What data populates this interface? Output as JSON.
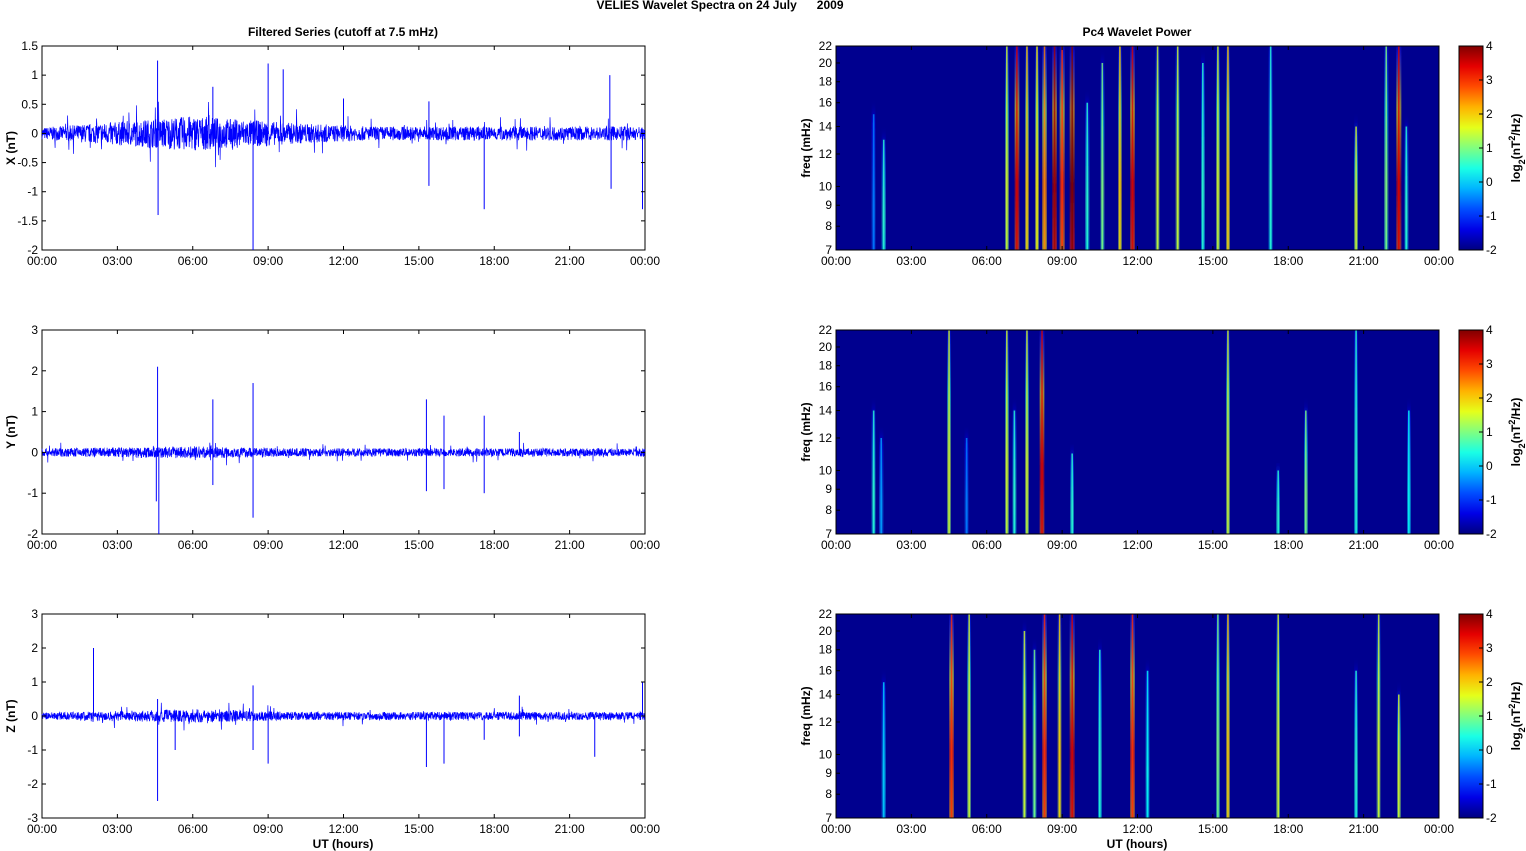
{
  "figure": {
    "title": "VELIES Wavelet Spectra on 24 July      2009",
    "left_title": "Filtered Series (cutoff at 7.5 mHz)",
    "right_title": "Pc4 Wavelet Power",
    "xlabel": "UT (hours)"
  },
  "colors": {
    "line": "#0000ff",
    "axis": "#000000",
    "background": "#00008f"
  },
  "chart_data": [
    {
      "type": "line",
      "name": "X",
      "ylabel": "X (nT)",
      "xlim": [
        0,
        24
      ],
      "ylim": [
        -2,
        1.5
      ],
      "yticks": [
        "-2",
        "-1.5",
        "-1",
        "-0.5",
        "0",
        "0.5",
        "1",
        "1.5"
      ],
      "xticks": [
        "00:00",
        "03:00",
        "06:00",
        "09:00",
        "12:00",
        "15:00",
        "18:00",
        "21:00",
        "00:00"
      ],
      "noise_amplitude": [
        [
          0,
          0.1
        ],
        [
          6,
          0.3
        ],
        [
          10,
          0.18
        ],
        [
          13,
          0.12
        ],
        [
          24,
          0.12
        ]
      ],
      "spikes": [
        [
          4.6,
          1.25
        ],
        [
          4.62,
          -1.4
        ],
        [
          6.8,
          0.8
        ],
        [
          8.4,
          -2.0
        ],
        [
          9.0,
          1.2
        ],
        [
          9.6,
          1.1
        ],
        [
          12.0,
          0.6
        ],
        [
          15.4,
          0.55
        ],
        [
          15.4,
          -0.9
        ],
        [
          17.6,
          -1.3
        ],
        [
          22.6,
          1.0
        ],
        [
          22.65,
          -0.95
        ],
        [
          23.9,
          -1.3
        ]
      ]
    },
    {
      "type": "line",
      "name": "Y",
      "ylabel": "Y (nT)",
      "xlim": [
        0,
        24
      ],
      "ylim": [
        -2,
        3
      ],
      "yticks": [
        "-2",
        "-1",
        "0",
        "1",
        "2",
        "3"
      ],
      "xticks": [
        "00:00",
        "03:00",
        "06:00",
        "09:00",
        "12:00",
        "15:00",
        "18:00",
        "21:00",
        "00:00"
      ],
      "noise_amplitude": [
        [
          0,
          0.1
        ],
        [
          6,
          0.15
        ],
        [
          10,
          0.1
        ],
        [
          24,
          0.1
        ]
      ],
      "spikes": [
        [
          4.6,
          2.1
        ],
        [
          4.65,
          -2.0
        ],
        [
          4.55,
          -1.2
        ],
        [
          6.8,
          1.3
        ],
        [
          6.8,
          -0.8
        ],
        [
          8.4,
          1.7
        ],
        [
          8.4,
          -1.6
        ],
        [
          15.3,
          1.3
        ],
        [
          15.3,
          -0.95
        ],
        [
          16.0,
          0.9
        ],
        [
          16.0,
          -0.9
        ],
        [
          17.6,
          0.9
        ],
        [
          17.6,
          -1.0
        ],
        [
          19.0,
          0.5
        ]
      ]
    },
    {
      "type": "line",
      "name": "Z",
      "ylabel": "Z (nT)",
      "xlim": [
        0,
        24
      ],
      "ylim": [
        -3,
        3
      ],
      "yticks": [
        "-3",
        "-2",
        "-1",
        "0",
        "1",
        "2",
        "3"
      ],
      "xticks": [
        "00:00",
        "03:00",
        "06:00",
        "09:00",
        "12:00",
        "15:00",
        "18:00",
        "21:00",
        "00:00"
      ],
      "noise_amplitude": [
        [
          0,
          0.1
        ],
        [
          6,
          0.2
        ],
        [
          10,
          0.12
        ],
        [
          24,
          0.12
        ]
      ],
      "spikes": [
        [
          2.05,
          2.0
        ],
        [
          4.6,
          -2.5
        ],
        [
          4.6,
          0.5
        ],
        [
          5.3,
          -1.0
        ],
        [
          8.4,
          0.9
        ],
        [
          8.4,
          -1.0
        ],
        [
          9.0,
          -1.4
        ],
        [
          15.3,
          -1.5
        ],
        [
          16.0,
          -1.4
        ],
        [
          17.6,
          -0.7
        ],
        [
          19.0,
          0.6
        ],
        [
          19.0,
          -0.6
        ],
        [
          22.0,
          -1.2
        ],
        [
          23.9,
          1.0
        ]
      ]
    },
    {
      "type": "heatmap",
      "name": "X power",
      "ylabel": "freq (mHz)",
      "yscale": "log",
      "xlim": [
        0,
        24
      ],
      "ylim": [
        7,
        22
      ],
      "yticks": [
        7,
        8,
        9,
        10,
        12,
        14,
        16,
        18,
        20,
        22
      ],
      "xticks": [
        "00:00",
        "03:00",
        "06:00",
        "09:00",
        "12:00",
        "15:00",
        "18:00",
        "21:00",
        "00:00"
      ],
      "colorbar": {
        "label": "log2(nT2/Hz)",
        "range": [
          -2,
          4
        ],
        "ticks": [
          "-2",
          "-1",
          "0",
          "1",
          "2",
          "3",
          "4"
        ]
      },
      "events": [
        [
          1.5,
          7,
          15,
          -0.5
        ],
        [
          1.9,
          7,
          13,
          0.5
        ],
        [
          6.8,
          7,
          22,
          1.5
        ],
        [
          7.2,
          7,
          22,
          3.5
        ],
        [
          7.6,
          7,
          22,
          2
        ],
        [
          8.0,
          7,
          22,
          1.8
        ],
        [
          8.3,
          7,
          22,
          2.5
        ],
        [
          8.7,
          7,
          22,
          3.8
        ],
        [
          9.0,
          7,
          22,
          3
        ],
        [
          9.4,
          7,
          22,
          4
        ],
        [
          10.0,
          7,
          16,
          0.5
        ],
        [
          10.6,
          7,
          20,
          1
        ],
        [
          11.3,
          7,
          22,
          2
        ],
        [
          11.8,
          7,
          22,
          3.5
        ],
        [
          12.8,
          7,
          22,
          1.5
        ],
        [
          13.6,
          7,
          22,
          1.5
        ],
        [
          14.6,
          7,
          20,
          0.5
        ],
        [
          15.2,
          7,
          22,
          1.5
        ],
        [
          15.6,
          7,
          22,
          2
        ],
        [
          17.3,
          7,
          22,
          0.5
        ],
        [
          20.7,
          7,
          14,
          1.5
        ],
        [
          21.9,
          7,
          22,
          1
        ],
        [
          22.4,
          7,
          22,
          3.5
        ],
        [
          22.7,
          7,
          14,
          0.5
        ]
      ]
    },
    {
      "type": "heatmap",
      "name": "Y power",
      "ylabel": "freq (mHz)",
      "yscale": "log",
      "xlim": [
        0,
        24
      ],
      "ylim": [
        7,
        22
      ],
      "yticks": [
        7,
        8,
        9,
        10,
        12,
        14,
        16,
        18,
        20,
        22
      ],
      "xticks": [
        "00:00",
        "03:00",
        "06:00",
        "09:00",
        "12:00",
        "15:00",
        "18:00",
        "21:00",
        "00:00"
      ],
      "colorbar": {
        "label": "log2(nT2/Hz)",
        "range": [
          -2,
          4
        ],
        "ticks": [
          "-2",
          "-1",
          "0",
          "1",
          "2",
          "3",
          "4"
        ]
      },
      "events": [
        [
          1.5,
          7,
          14,
          0.5
        ],
        [
          1.8,
          7,
          12,
          -0.3
        ],
        [
          4.5,
          7,
          22,
          1.5
        ],
        [
          5.2,
          7,
          12,
          -0.5
        ],
        [
          6.8,
          7,
          22,
          1.5
        ],
        [
          7.1,
          7,
          14,
          0.5
        ],
        [
          7.6,
          7,
          22,
          1.5
        ],
        [
          8.2,
          7,
          22,
          3.5
        ],
        [
          9.4,
          7,
          11,
          0.5
        ],
        [
          15.6,
          7,
          22,
          1.5
        ],
        [
          17.6,
          7,
          10,
          0.5
        ],
        [
          18.7,
          7,
          14,
          1
        ],
        [
          20.7,
          7,
          22,
          0.5
        ],
        [
          22.8,
          7,
          14,
          0.3
        ]
      ]
    },
    {
      "type": "heatmap",
      "name": "Z power",
      "ylabel": "freq (mHz)",
      "yscale": "log",
      "xlim": [
        0,
        24
      ],
      "ylim": [
        7,
        22
      ],
      "yticks": [
        7,
        8,
        9,
        10,
        12,
        14,
        16,
        18,
        20,
        22
      ],
      "xticks": [
        "00:00",
        "03:00",
        "06:00",
        "09:00",
        "12:00",
        "15:00",
        "18:00",
        "21:00",
        "00:00"
      ],
      "colorbar": {
        "label": "log2(nT2/Hz)",
        "range": [
          -2,
          4
        ],
        "ticks": [
          "-2",
          "-1",
          "0",
          "1",
          "2",
          "3",
          "4"
        ]
      },
      "events": [
        [
          1.9,
          7,
          15,
          0
        ],
        [
          4.6,
          7,
          22,
          3
        ],
        [
          5.3,
          7,
          22,
          1.5
        ],
        [
          7.5,
          7,
          20,
          1.5
        ],
        [
          7.9,
          7,
          18,
          1
        ],
        [
          8.3,
          7,
          22,
          3
        ],
        [
          8.9,
          7,
          22,
          2
        ],
        [
          9.4,
          7,
          22,
          3.5
        ],
        [
          10.5,
          7,
          18,
          0.5
        ],
        [
          11.8,
          7,
          22,
          3
        ],
        [
          12.4,
          7,
          16,
          0.3
        ],
        [
          15.2,
          7,
          22,
          1
        ],
        [
          15.6,
          7,
          22,
          2
        ],
        [
          17.6,
          7,
          22,
          1.5
        ],
        [
          20.7,
          7,
          16,
          0.5
        ],
        [
          21.6,
          7,
          22,
          1.5
        ],
        [
          22.4,
          7,
          14,
          1.5
        ]
      ]
    }
  ]
}
